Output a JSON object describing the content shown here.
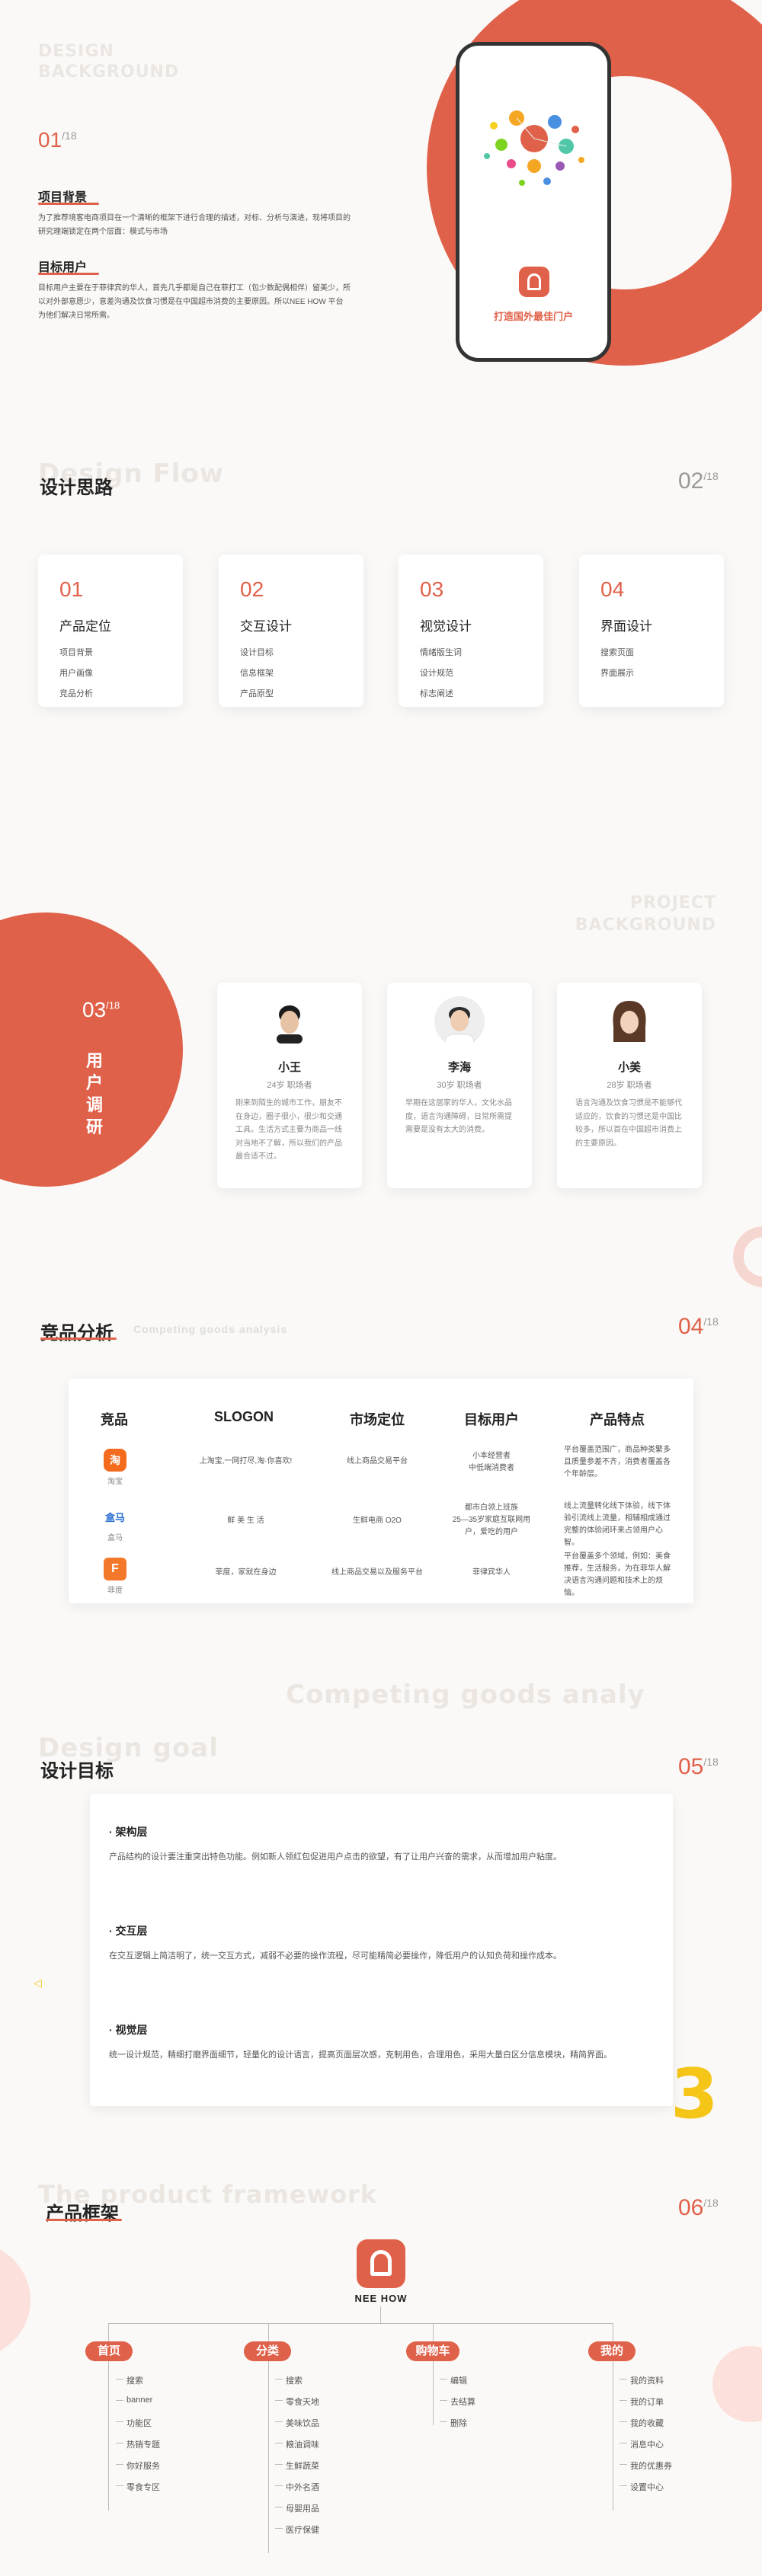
{
  "s1": {
    "ghost": [
      "DESIGN",
      "BACKGROUND"
    ],
    "num": "01",
    "sup": "/18",
    "h1": "项目背景",
    "p1": "为了推荐境客电商项目在一个清晰的框架下进行合理的描述，对标、分析与演进，现将项目的研究理端锁定在两个层面：模式与市场",
    "h2": "目标用户",
    "p2": "目标用户主要在于菲律宾的华人，首先几乎都是自己在菲打工（包少数配偶相伴）留美少，所以对外部意愿少，意差沟通及饮食习惯是在中国超市消费的主要原因。所以NEE HOW 平台为他们解决日常所需。",
    "phone_slogan": "打造国外最佳门户"
  },
  "s2": {
    "ghost": "Design Flow",
    "title": "设计思路",
    "num": "02",
    "sup": "/18",
    "cards": [
      {
        "n": "01",
        "t": "产品定位",
        "items": [
          "项目背景",
          "用户画像",
          "竞品分析"
        ]
      },
      {
        "n": "02",
        "t": "交互设计",
        "items": [
          "设计目标",
          "信息框架",
          "产品原型"
        ]
      },
      {
        "n": "03",
        "t": "视觉设计",
        "items": [
          "情绪版生词",
          "设计规范",
          "标志阐述"
        ]
      },
      {
        "n": "04",
        "t": "界面设计",
        "items": [
          "搜索页面",
          "界面展示"
        ]
      }
    ]
  },
  "s3": {
    "ghost": [
      "PROJECT",
      "BACKGROUND"
    ],
    "num": "03",
    "sup": "/18",
    "vtitle": [
      "用",
      "户",
      "调",
      "研"
    ],
    "users": [
      {
        "name": "小王",
        "meta": "24岁  职场者",
        "desc": "刚来到陌生的城市工作，朋友不在身边，圈子很小，很少和交通工具。生活方式主要为商品一线对当地不了解，所以我们的产品最合适不过。"
      },
      {
        "name": "李海",
        "meta": "30岁  职场者",
        "desc": "早期在这居家的华人，文化水品度，语言沟通障碍，日常所需提需要是没有太大的消费。"
      },
      {
        "name": "小美",
        "meta": "28岁  职场者",
        "desc": "语言沟通及饮食习惯是不能够代适应的，饮食的习惯还是中国比较多，所以首在中国超市消费上的主要原因。"
      }
    ]
  },
  "s4": {
    "title": "竞品分析",
    "subtitle": "Competing goods analysis",
    "num": "04",
    "sup": "/18",
    "ghost": "Competing goods analy",
    "headers": [
      "竞品",
      "SLOGON",
      "市场定位",
      "目标用户",
      "产品特点"
    ],
    "rows": [
      {
        "brand": "淘宝",
        "icon": "淘",
        "color": "#f46b1e",
        "slogan": "上淘宝,一网打尽,淘·你喜欢!",
        "market": "线上商品交易平台",
        "users": "小本经营者\n中低端消费者",
        "feature": "平台覆盖范围广，商品种类繁多且质量参差不齐，消费者覆盖各个年龄层。"
      },
      {
        "brand": "盒马",
        "icon": "盒马",
        "color": "#2a6fd3",
        "slogan": "鲜  美  生  活",
        "market": "生鲜电商 O2O",
        "users": "都市白领上班族\n25—35岁家庭互联网用户，爱吃的用户",
        "feature": "线上流量转化线下体验，线下体验引流线上流量，相辅相成通过完整的体验闭环来占领用户心智。"
      },
      {
        "brand": "菲度",
        "icon": "F",
        "color": "#f3782a",
        "slogan": "菲度，家就在身边",
        "market": "线上商品交易以及服务平台",
        "users": "菲律宾华人",
        "feature": "平台覆盖多个领域，例如：美食推荐，生活服务，为在菲华人解决语言沟通问题和技术上的烦恼。"
      }
    ]
  },
  "s5": {
    "ghost": "Design goal",
    "title": "设计目标",
    "num": "05",
    "sup": "/18",
    "blocks": [
      {
        "h": "· 架构层",
        "p": "产品结构的设计要注重突出特色功能。例如新人领红包促进用户点击的欲望，有了让用户兴奋的需求，从而增加用户粘度。"
      },
      {
        "h": "· 交互层",
        "p": "在交互逻辑上简洁明了，统一交互方式，减弱不必要的操作流程，尽可能精简必要操作，降低用户的认知负荷和操作成本。"
      },
      {
        "h": "· 视觉层",
        "p": "统一设计规范，精细打磨界面细节，轻量化的设计语言，提高页面层次感，克制用色，合理用色，采用大量白区分信息模块，精简界面。"
      }
    ]
  },
  "s6": {
    "ghost": "The product framework",
    "title": "产品框架",
    "num": "06",
    "sup": "/18",
    "root": "NEE HOW",
    "branches": [
      {
        "label": "首页",
        "items": [
          "搜索",
          "banner",
          "功能区",
          "热销专题",
          "你好服务",
          "零食专区"
        ]
      },
      {
        "label": "分类",
        "items": [
          "搜索",
          "零食天地",
          "美味饮品",
          "粮油调味",
          "生鲜蔬菜",
          "中外名酒",
          "母婴用品",
          "医疗保健"
        ]
      },
      {
        "label": "购物车",
        "items": [
          "编辑",
          "去结算",
          "删除"
        ]
      },
      {
        "label": "我的",
        "items": [
          "我的资料",
          "我的订单",
          "我的收藏",
          "消息中心",
          "我的优惠券",
          "设置中心"
        ]
      }
    ]
  }
}
